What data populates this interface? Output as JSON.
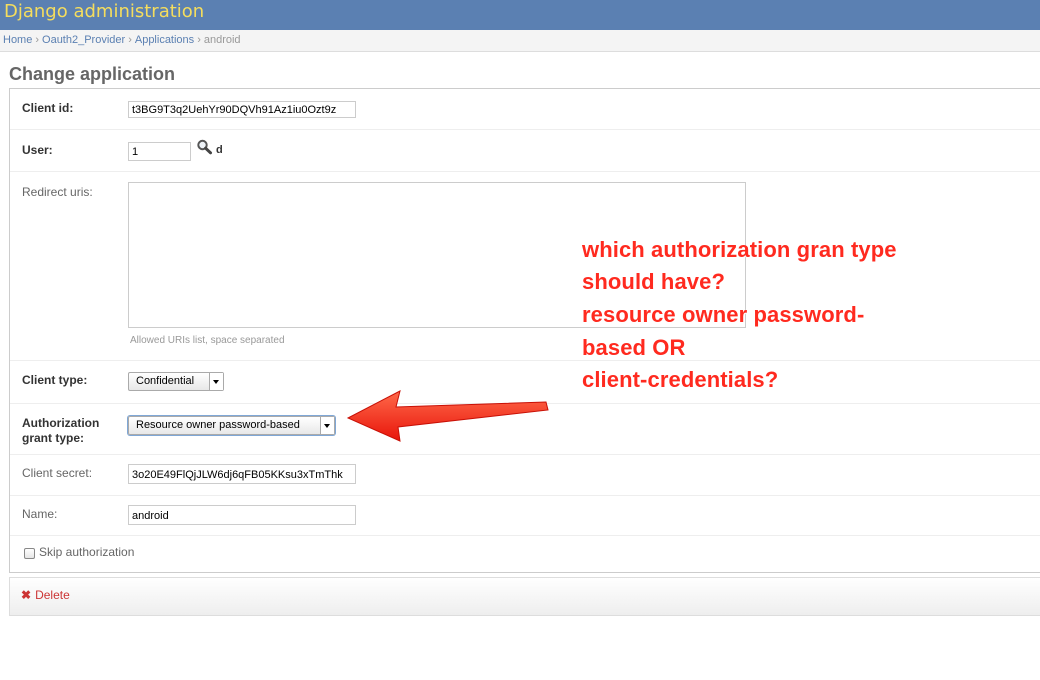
{
  "header": {
    "site_title": "Django administration"
  },
  "breadcrumbs": {
    "items": [
      "Home",
      "Oauth2_Provider",
      "Applications"
    ],
    "current": "android",
    "separator": "›"
  },
  "page": {
    "title": "Change application"
  },
  "form": {
    "client_id": {
      "label": "Client id:",
      "value": "t3BG9T3q2UehYr90DQVh91Az1iu0Ozt9z"
    },
    "user": {
      "label": "User:",
      "value": "1",
      "lookup_text": "d"
    },
    "redirect_uris": {
      "label": "Redirect uris:",
      "value": "",
      "help": "Allowed URIs list, space separated"
    },
    "client_type": {
      "label": "Client type:",
      "selected": "Confidential"
    },
    "authorization_grant_type": {
      "label_line1": "Authorization",
      "label_line2": "grant type:",
      "selected": "Resource owner password-based"
    },
    "client_secret": {
      "label": "Client secret:",
      "value": "3o20E49FlQjJLW6dj6qFB05KKsu3xTmThk"
    },
    "name": {
      "label": "Name:",
      "value": "android"
    },
    "skip_authorization": {
      "label": "Skip authorization",
      "checked": false
    }
  },
  "actions": {
    "delete_label": "Delete"
  },
  "annotation": {
    "lines": [
      "which authorization gran type",
      "should have?",
      "resource owner password-",
      "based OR",
      "client-credentials?"
    ],
    "color": "#ff2a1f"
  },
  "colors": {
    "header_bg": "#5b80b2",
    "site_title": "#f5dd5d",
    "link": "#5b80b2",
    "delete": "#cc3434"
  },
  "icons": {
    "lookup": "magnifier-icon",
    "delete": "delete-x-icon",
    "arrow": "red-arrow"
  }
}
